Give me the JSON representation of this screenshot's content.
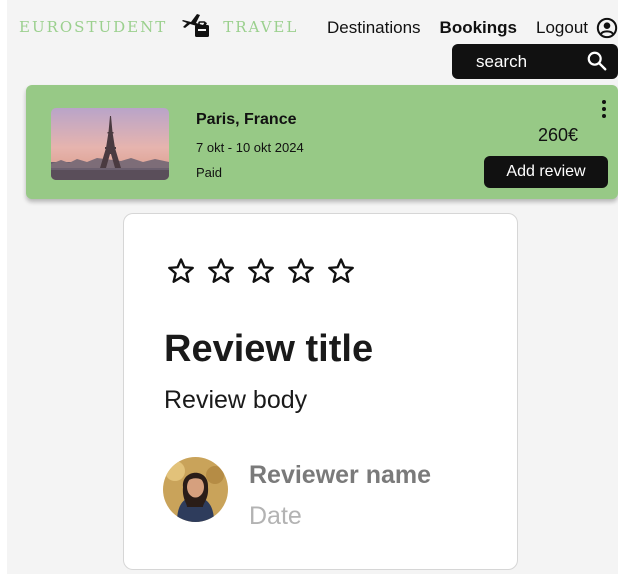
{
  "header": {
    "brand_left": "EUROSTUDENT",
    "brand_right": "TRAVEL",
    "logo_icon": "plane-luggage-icon",
    "nav": {
      "destinations": "Destinations",
      "bookings": "Bookings",
      "logout": "Logout"
    },
    "user_icon": "user-circle-icon"
  },
  "search": {
    "placeholder": "search",
    "icon": "search-icon"
  },
  "booking": {
    "image": "eiffel-tower-photo",
    "title": "Paris, France",
    "dates": "7 okt - 10 okt 2024",
    "status": "Paid",
    "price": "260€",
    "menu_icon": "kebab-menu-icon",
    "add_review_label": "Add review"
  },
  "review": {
    "rating": 0,
    "star_count": 5,
    "star_icon": "star-outline-icon",
    "title": "Review title",
    "body": "Review body",
    "avatar": "reviewer-avatar",
    "reviewer_name": "Reviewer name",
    "date": "Date"
  },
  "colors": {
    "accent_green": "#97c986",
    "brand_green": "#9bd08e",
    "dark": "#111111",
    "background": "#f4f4f4"
  }
}
